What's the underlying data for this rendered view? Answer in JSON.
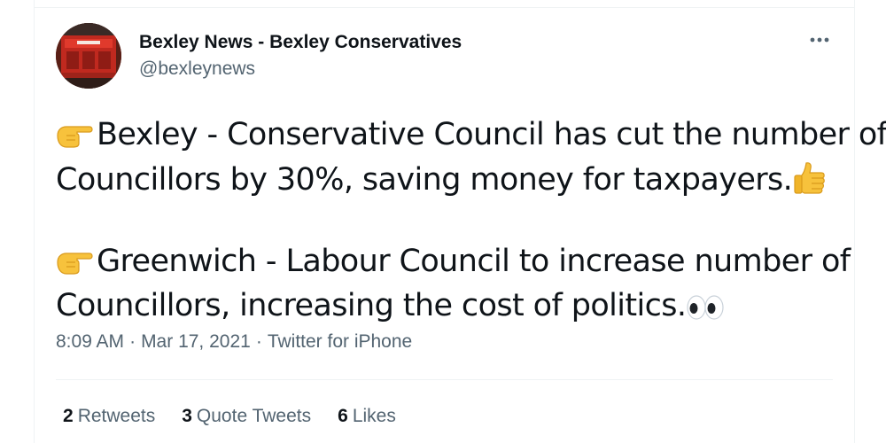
{
  "author": {
    "display_name": "Bexley News - Bexley Conservatives",
    "handle": "@bexleynews"
  },
  "more_menu_icon": "more-horizontal-icon",
  "tweet": {
    "paragraphs": [
      {
        "lead_emoji": "backhand-index-pointing-right-emoji",
        "line1": "Bexley - Conservative Council has cut the number of",
        "line2": "Councillors by 30%, saving money for taxpayers.",
        "trail_emoji": "thumbs-up-emoji"
      },
      {
        "lead_emoji": "backhand-index-pointing-right-emoji",
        "line1": "Greenwich - Labour Council to increase number of",
        "line2": "Councillors, increasing the cost of politics.",
        "trail_emoji": "eyes-emoji"
      }
    ]
  },
  "meta": {
    "time": "8:09 AM",
    "separator": "·",
    "date": "Mar 17, 2021",
    "source": "Twitter for iPhone"
  },
  "stats": {
    "retweets_count": "2",
    "retweets_label": "Retweets",
    "quotes_count": "3",
    "quotes_label": "Quote Tweets",
    "likes_count": "6",
    "likes_label": "Likes"
  },
  "colors": {
    "text_primary": "#0f1419",
    "text_secondary": "#536471",
    "divider": "#eff3f4",
    "emoji_yellow": "#f7c23c"
  }
}
